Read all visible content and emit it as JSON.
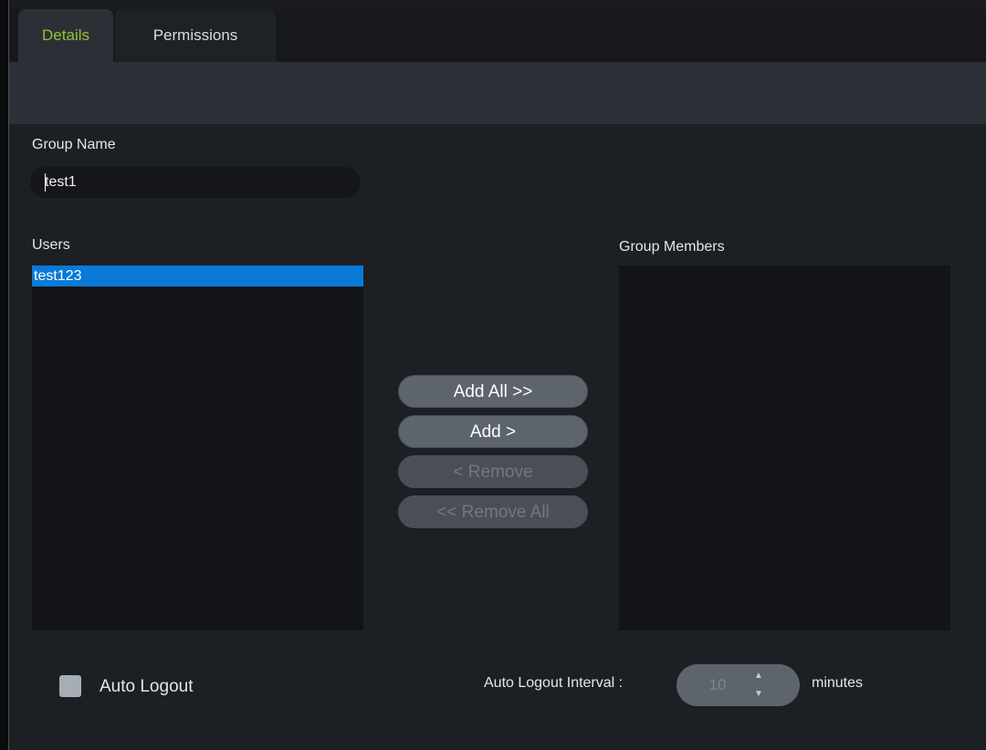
{
  "tabs": {
    "details": "Details",
    "permissions": "Permissions"
  },
  "group_name": {
    "label": "Group Name",
    "value": "test1"
  },
  "users": {
    "label": "Users",
    "items": [
      "test123"
    ]
  },
  "group_members": {
    "label": "Group Members",
    "items": []
  },
  "buttons": {
    "add_all": "Add All >>",
    "add": "Add >",
    "remove": "< Remove",
    "remove_all": "<< Remove All"
  },
  "auto_logout": {
    "label": "Auto Logout",
    "checked": false,
    "interval_label": "Auto Logout Interval :",
    "interval_value": "10",
    "unit": "minutes"
  },
  "icons": {
    "spin_up": "spin-up-icon",
    "spin_down": "spin-down-icon"
  },
  "colors": {
    "active_tab_text": "#93c13a",
    "selection": "#0a7ad8",
    "background": "#1c1f24"
  }
}
